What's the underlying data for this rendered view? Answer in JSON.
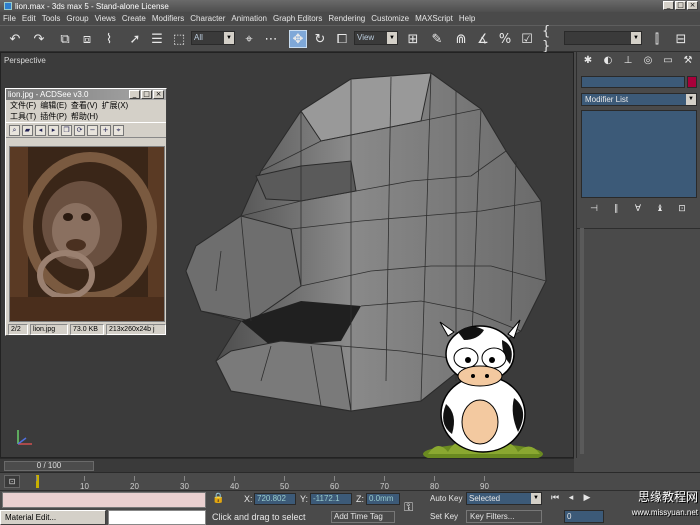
{
  "window": {
    "title": "lion.max - 3ds max 5 - Stand-alone License",
    "min": "_",
    "max": "□",
    "close": "×"
  },
  "menu": [
    "File",
    "Edit",
    "Tools",
    "Group",
    "Views",
    "Create",
    "Modifiers",
    "Character",
    "Animation",
    "Graph Editors",
    "Rendering",
    "Customize",
    "MAXScript",
    "Help"
  ],
  "toolbar": {
    "selection_filter": "All",
    "ref_coord": "View",
    "named_selection": ""
  },
  "viewport": {
    "label": "Perspective"
  },
  "acdsee": {
    "title": "lion.jpg - ACDSee v3.0",
    "menu_row1": [
      "文件(F)",
      "编辑(E)",
      "查看(V)",
      "扩展(X)"
    ],
    "menu_row2": [
      "工具(T)",
      "插件(P)",
      "帮助(H)"
    ],
    "status": [
      "2/2",
      "lion.jpg",
      "73.0 KB",
      "213x260x24b j"
    ]
  },
  "command_panel": {
    "modifier_list": "Modifier List"
  },
  "timeline": {
    "position": "0 / 100",
    "ticks": [
      "10",
      "20",
      "30",
      "40",
      "50",
      "60",
      "70",
      "80",
      "90"
    ]
  },
  "status": {
    "task_label": "Material Edit...",
    "x_label": "X:",
    "x_value": "720.802",
    "y_label": "Y:",
    "y_value": "-1172.1",
    "z_label": "Z:",
    "z_value": "0.0mm",
    "prompt": "Click and drag to select",
    "add_time_tag": "Add Time Tag",
    "auto_key": "Auto Key",
    "set_key": "Set Key",
    "selected": "Selected",
    "key_filters": "Key Filters...",
    "frame": "0"
  },
  "watermark": {
    "text": "思缘教程网",
    "url": "www.missyuan.net"
  },
  "colors": {
    "ui_gray": "#4a4a4a",
    "field_blue": "#3c5a78",
    "active_tool": "#7fa8d8",
    "object_color": "#a8003a"
  }
}
